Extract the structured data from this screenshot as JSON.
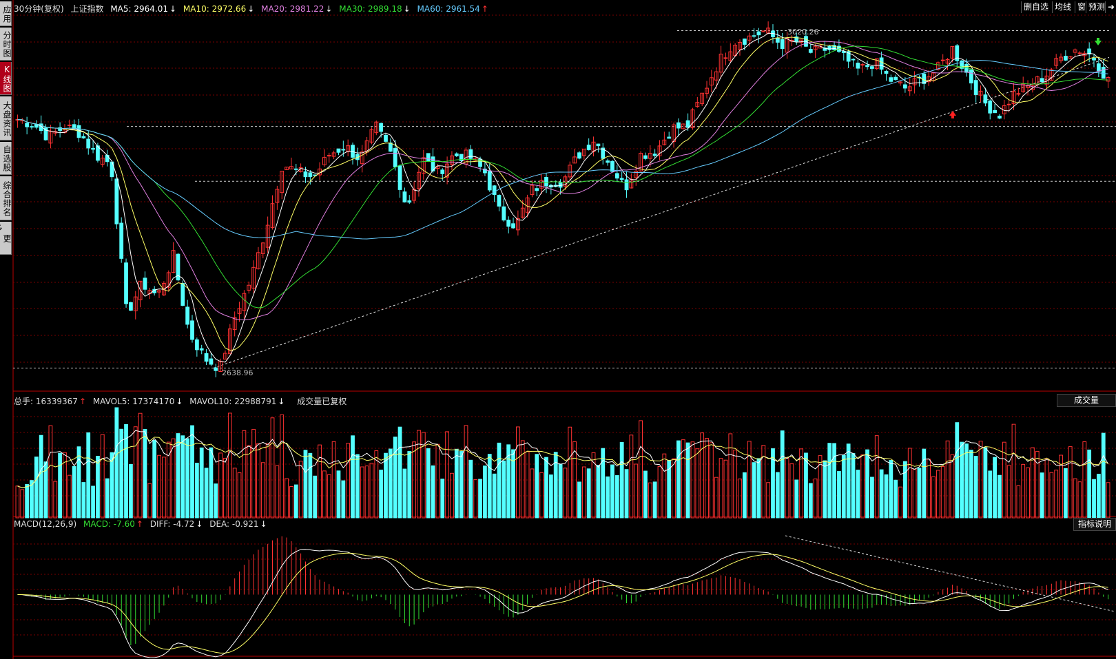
{
  "sidebar": {
    "tabs": [
      {
        "label": "应用",
        "active": false
      },
      {
        "label": "分时图",
        "active": false
      },
      {
        "label": "K线图",
        "active": true
      },
      {
        "label": "大盘资讯",
        "active": false
      },
      {
        "label": "自选股",
        "active": false
      },
      {
        "label": "综合排名",
        "active": false
      },
      {
        "label": "更多..",
        "active": false
      }
    ]
  },
  "header": {
    "period": "30分钟(复权)",
    "index_name": "上证指数",
    "ma5": {
      "label": "MA5: 2964.01",
      "arrow": "↓",
      "color": "#ffffff"
    },
    "ma10": {
      "label": "MA10: 2972.66",
      "arrow": "↓",
      "color": "#ffff66"
    },
    "ma20": {
      "label": "MA20: 2981.22",
      "arrow": "↓",
      "color": "#e080e0"
    },
    "ma30": {
      "label": "MA30: 2989.18",
      "arrow": "↓",
      "color": "#33dd33"
    },
    "ma60": {
      "label": "MA60: 2961.54",
      "arrow": "↑",
      "color": "#66ccff"
    }
  },
  "toolbar": {
    "delete_watch": "删自选",
    "ma_line": "均线",
    "grid": "窗",
    "forecast": "预测",
    "more_arrow": "➜"
  },
  "volume_header": {
    "total": "总手: 16339367",
    "total_arrow": "↑",
    "mavol5": "MAVOL5: 17374170",
    "mavol5_arrow": "↓",
    "mavol10": "MAVOL10: 22988791",
    "mavol10_arrow": "↓",
    "note": "成交量已复权",
    "button": "成交量"
  },
  "macd_header": {
    "name": "MACD(12,26,9)",
    "macd": "MACD: -7.60",
    "macd_arrow": "↑",
    "diff": "DIFF: -4.72",
    "diff_arrow": "↓",
    "dea": "DEA: -0.921",
    "dea_arrow": "↓",
    "button": "指标说明"
  },
  "annotations": {
    "high_label": "3020.26",
    "low_label": "2638.96"
  },
  "colors": {
    "up": "#ff3232",
    "down": "#54ffff",
    "ma5": "#ffffff",
    "ma10": "#ffff66",
    "ma20": "#e080e0",
    "ma30": "#33dd33",
    "ma60": "#66ccff",
    "grid": "#7a0000"
  },
  "chart_data": [
    {
      "type": "candlestick",
      "title": "30分钟(复权) 上证指数",
      "ylim": [
        2630,
        3030
      ],
      "high": 3020.26,
      "low": 2638.96,
      "series": [
        {
          "name": "MA5",
          "last": 2964.01
        },
        {
          "name": "MA10",
          "last": 2972.66
        },
        {
          "name": "MA20",
          "last": 2981.22
        },
        {
          "name": "MA30",
          "last": 2989.18
        },
        {
          "name": "MA60",
          "last": 2961.54
        }
      ],
      "close_path": [
        2920,
        2915,
        2900,
        2912,
        2905,
        2880,
        2870,
        2700,
        2735,
        2720,
        2765,
        2680,
        2650,
        2638.96,
        2700,
        2740,
        2800,
        2870,
        2860,
        2855,
        2880,
        2890,
        2875,
        2912,
        2880,
        2820,
        2875,
        2860,
        2880,
        2878,
        2860,
        2812,
        2800,
        2840,
        2850,
        2850,
        2880,
        2898,
        2870,
        2842,
        2880,
        2885,
        2910,
        2912,
        2950,
        2985,
        3008,
        3013,
        3020.26,
        3005,
        3008,
        2995,
        3000,
        2990,
        2975,
        2985,
        2965,
        2955,
        2965,
        2975,
        3000,
        2970,
        2940,
        2925,
        2950,
        2958,
        2970,
        2990,
        3000,
        2992,
        2964
      ]
    },
    {
      "type": "bar",
      "title": "成交量",
      "series": [
        {
          "name": "总手",
          "last": 16339367
        },
        {
          "name": "MAVOL5",
          "last": 17374170
        },
        {
          "name": "MAVOL10",
          "last": 22988791
        }
      ]
    },
    {
      "type": "line",
      "title": "MACD(12,26,9)",
      "series": [
        {
          "name": "MACD",
          "last": -7.6
        },
        {
          "name": "DIFF",
          "last": -4.72
        },
        {
          "name": "DEA",
          "last": -0.921
        }
      ]
    }
  ]
}
